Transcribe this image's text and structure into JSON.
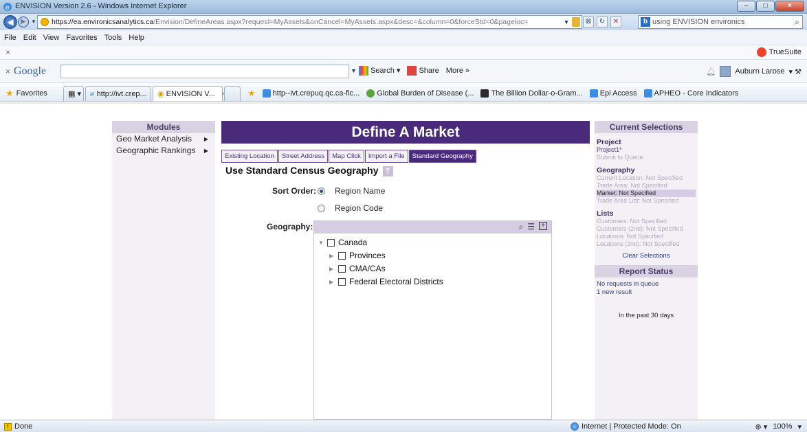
{
  "browser": {
    "window_title": "ENVISION Version 2.6 - Windows Internet Explorer",
    "url_host": "https://ea.environicsanalytics.ca",
    "url_path": "/Envision/DefineAreas.aspx?request=MyAssets&onCancel=MyAssets.aspx&desc=&column=0&forceStd=0&pageloc=",
    "search_text": "using ENVISION environics",
    "menu": [
      "File",
      "Edit",
      "View",
      "Favorites",
      "Tools",
      "Help"
    ],
    "truesuite": "TrueSuite",
    "google_toolbar": {
      "logo": "Google",
      "search_label": "Search",
      "share_label": "Share",
      "more_label": "More »",
      "user": "Auburn Larose"
    },
    "favorites_label": "Favorites",
    "tabs": [
      {
        "label": "http://ivt.crep..."
      },
      {
        "label": "ENVISION V..."
      }
    ],
    "fav_links": [
      "http--ivt.crepuq.qc.ca-fic...",
      "Global Burden of Disease (...",
      "The Billion Dollar-o-Gram...",
      "Epi Access",
      "APHEO - Core Indicators"
    ],
    "status": {
      "left": "Done",
      "zone": "Internet | Protected Mode: On",
      "zoom": "100%"
    }
  },
  "modules": {
    "title": "Modules",
    "items": [
      "Geo Market Analysis",
      "Geographic Rankings"
    ]
  },
  "main": {
    "title": "Define A Market",
    "tabs": [
      "Existing Location",
      "Street Address",
      "Map Click",
      "Import a File",
      "Standard Geography"
    ],
    "active_tab": "Standard Geography",
    "section_title": "Use Standard Census Geography",
    "help_icon": "?",
    "sort_label": "Sort Order:",
    "sort_options": [
      "Region Name",
      "Region Code"
    ],
    "sort_selected": "Region Name",
    "geography_label": "Geography:",
    "tree": {
      "root": "Canada",
      "children": [
        "Provinces",
        "CMA/CAs",
        "Federal Electoral Districts"
      ]
    }
  },
  "current_selections": {
    "title": "Current Selections",
    "project_head": "Project",
    "project_name": "Project1*",
    "submit": "Submit to Queue",
    "geography_head": "Geography",
    "geography_lines": [
      "Current Location: Not Specified",
      "Trade Area: Not Specified",
      "Market: Not Specified",
      "Trade Area List: Not Specified"
    ],
    "lists_head": "Lists",
    "lists_lines": [
      "Customers: Not Specified",
      "Customers (2nd): Not Specified",
      "Locations: Not Specified",
      "Locations (2nd): Not Specified"
    ],
    "clear": "Clear Selections"
  },
  "report_status": {
    "title": "Report Status",
    "line1": "No requests in queue",
    "line2": "1 new result",
    "period": "In the past 30 days"
  },
  "colors": {
    "brand_purple": "#4a2a7a",
    "panel_bg": "#f3f0f6"
  }
}
